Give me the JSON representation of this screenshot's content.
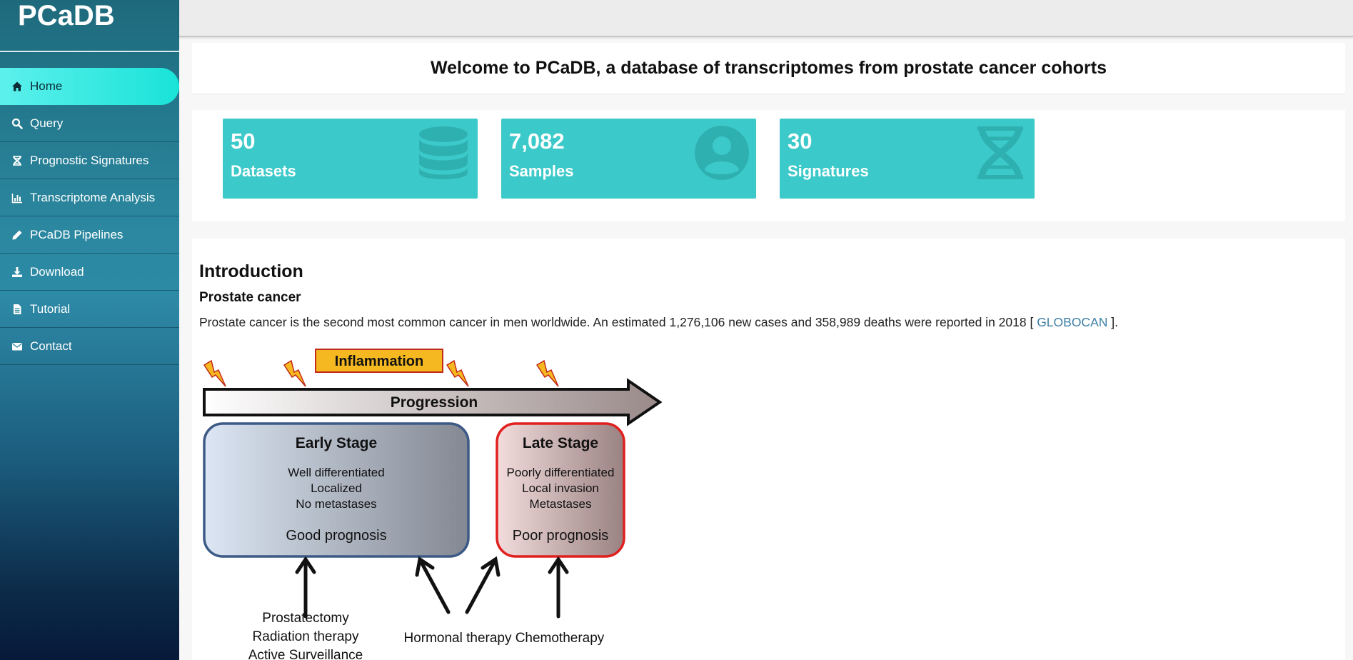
{
  "brand": "PCaDB",
  "nav": [
    {
      "label": "Home",
      "icon": "home-icon"
    },
    {
      "label": "Query",
      "icon": "search-icon"
    },
    {
      "label": "Prognostic Signatures",
      "icon": "dna-icon"
    },
    {
      "label": "Transcriptome Analysis",
      "icon": "bar-chart-icon"
    },
    {
      "label": "PCaDB Pipelines",
      "icon": "pencil-icon"
    },
    {
      "label": "Download",
      "icon": "download-icon"
    },
    {
      "label": "Tutorial",
      "icon": "file-icon"
    },
    {
      "label": "Contact",
      "icon": "envelope-icon"
    }
  ],
  "welcome": "Welcome to PCaDB, a database of transcriptomes from prostate cancer cohorts",
  "stats": [
    {
      "value": "50",
      "label": "Datasets",
      "icon": "database-icon"
    },
    {
      "value": "7,082",
      "label": "Samples",
      "icon": "user-circle-icon"
    },
    {
      "value": "30",
      "label": "Signatures",
      "icon": "dna-icon"
    }
  ],
  "intro": {
    "title": "Introduction",
    "subtitle": "Prostate cancer",
    "text_before": "Prostate cancer is the second most common cancer in men worldwide. An estimated 1,276,106 new cases and 358,989 deaths were reported in 2018 [ ",
    "link": "GLOBOCAN",
    "text_after": " ]."
  },
  "diagram": {
    "inflammation": "Inflammation",
    "progression": "Progression",
    "early": {
      "title": "Early Stage",
      "lines": [
        "Well differentiated",
        "Localized",
        "No metastases"
      ],
      "prognosis": "Good prognosis"
    },
    "late": {
      "title": "Late Stage",
      "lines": [
        "Poorly differentiated",
        "Local invasion",
        "Metastases"
      ],
      "prognosis": "Poor prognosis"
    },
    "treatments": {
      "early": [
        "Prostatectomy",
        "Radiation therapy",
        "Active Surveillance"
      ],
      "hormonal": "Hormonal therapy",
      "chemo": "Chemotherapy"
    }
  },
  "colors": {
    "accent": "#3cc9c9",
    "active_nav": "#19e3d8",
    "link": "#3d7ea6",
    "inflammation_fill": "#f5b820",
    "early_border": "#3d5a86",
    "late_border": "#e0201e"
  }
}
